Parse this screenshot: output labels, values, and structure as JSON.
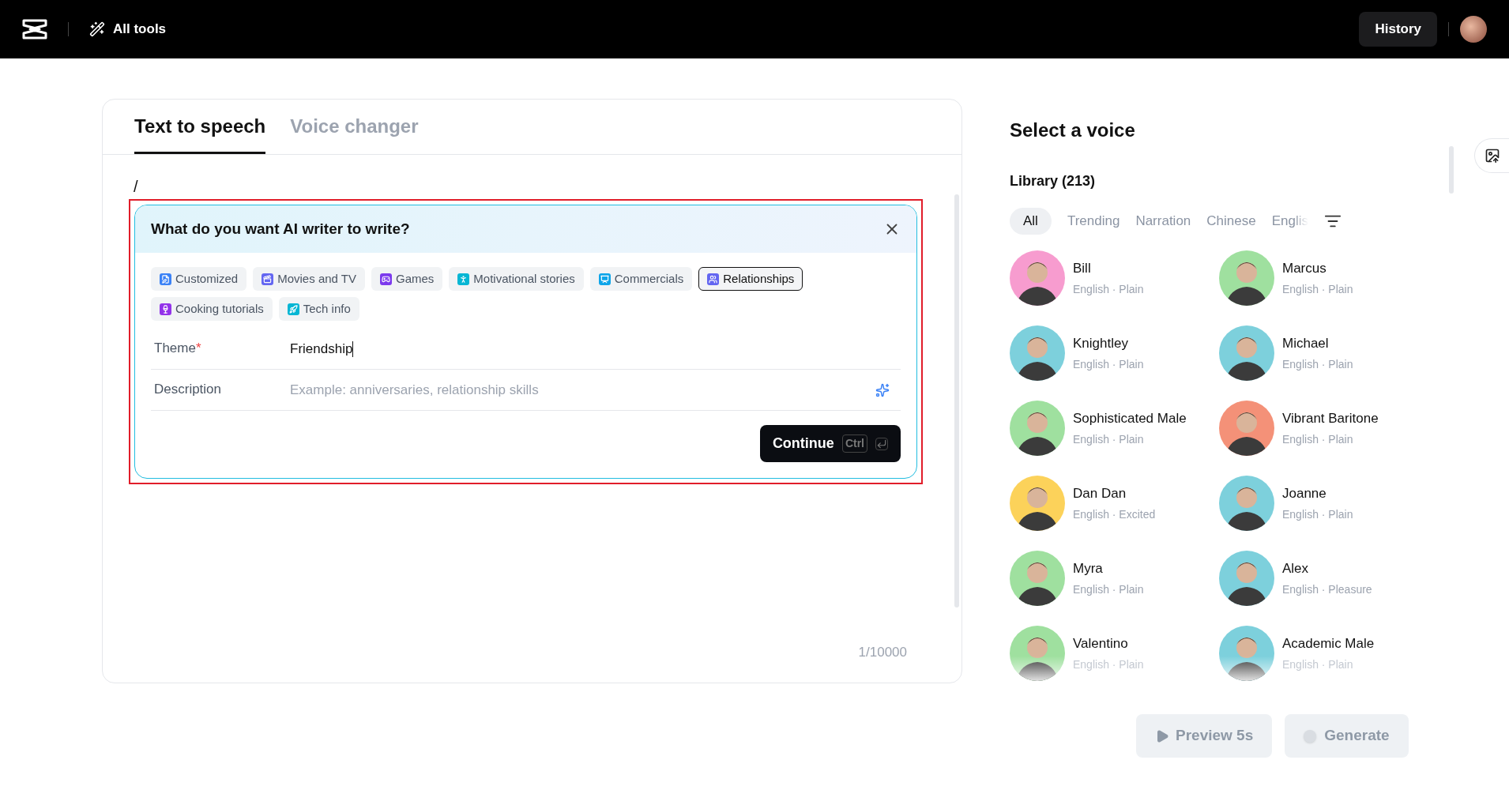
{
  "header": {
    "tools_label": "All tools",
    "history_button": "History"
  },
  "editor": {
    "tabs": [
      {
        "label": "Text to speech",
        "selected": true
      },
      {
        "label": "Voice changer",
        "selected": false
      }
    ],
    "text": "/",
    "counter": "1/10000",
    "ai_writer": {
      "title": "What do you want AI writer to write?",
      "chips": [
        {
          "label": "Customized",
          "kind": "pen",
          "color": "#3b82f6",
          "selected": false
        },
        {
          "label": "Movies and TV",
          "kind": "clapper",
          "color": "#6366f1",
          "selected": false
        },
        {
          "label": "Games",
          "kind": "gamepad",
          "color": "#7c3aed",
          "selected": false
        },
        {
          "label": "Motivational stories",
          "kind": "person",
          "color": "#06b6d4",
          "selected": false
        },
        {
          "label": "Commercials",
          "kind": "board",
          "color": "#0ea5e9",
          "selected": false
        },
        {
          "label": "Relationships",
          "kind": "users",
          "color": "#6366f1",
          "selected": true
        },
        {
          "label": "Cooking tutorials",
          "kind": "wine",
          "color": "#9333ea",
          "selected": false
        },
        {
          "label": "Tech info",
          "kind": "rocket",
          "color": "#06b6d4",
          "selected": false
        }
      ],
      "fields": [
        {
          "label": "Theme",
          "marker": "*",
          "value": "Friendship"
        },
        {
          "label": "Description",
          "placeholder": "Example: anniversaries, relationship skills"
        }
      ],
      "continue_button": "Continue",
      "shortcut": "Ctrl"
    }
  },
  "voices": {
    "title": "Select a voice",
    "library": "Library (213)",
    "filters": [
      {
        "label": "All",
        "selected": true
      },
      {
        "label": "Trending",
        "selected": false
      },
      {
        "label": "Narration",
        "selected": false
      },
      {
        "label": "Chinese",
        "selected": false
      },
      {
        "label": "Englis",
        "selected": false
      }
    ],
    "items": [
      {
        "name": "Bill",
        "info": "English · Plain",
        "color": "#f79ccf"
      },
      {
        "name": "Marcus",
        "info": "English · Plain",
        "color": "#9fe09f"
      },
      {
        "name": "Knightley",
        "info": "English · Plain",
        "color": "#7dd0dc"
      },
      {
        "name": "Michael",
        "info": "English · Plain",
        "color": "#7dd0dc"
      },
      {
        "name": "Sophisticated Male",
        "info": "English · Plain",
        "color": "#9fe09f"
      },
      {
        "name": "Vibrant Baritone",
        "info": "English · Plain",
        "color": "#f49178"
      },
      {
        "name": "Dan Dan",
        "info": "English · Excited",
        "color": "#fcd25a"
      },
      {
        "name": "Joanne",
        "info": "English · Plain",
        "color": "#7dd0dc"
      },
      {
        "name": "Myra",
        "info": "English · Plain",
        "color": "#9fe09f"
      },
      {
        "name": "Alex",
        "info": "English · Pleasure",
        "color": "#7dd0dc"
      },
      {
        "name": "Valentino",
        "info": "English · Plain",
        "color": "#9fe09f"
      },
      {
        "name": "Academic Male",
        "info": "English · Plain",
        "color": "#7dd0dc"
      }
    ],
    "preview_button": {
      "label": "Preview 5s",
      "disabled": true
    },
    "generate_button": {
      "label": "Generate",
      "disabled": true
    }
  }
}
